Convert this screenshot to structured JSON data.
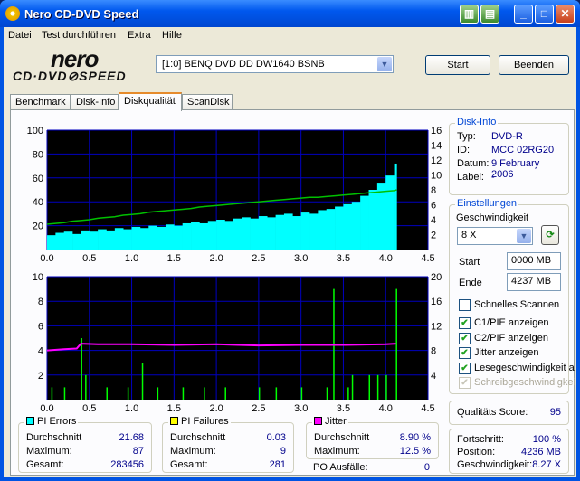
{
  "window": {
    "title": "Nero CD-DVD Speed"
  },
  "menu": [
    "Datei",
    "Test durchführen",
    "Extra",
    "Hilfe"
  ],
  "logo": {
    "top": "nero",
    "bottom": "CD·DVD SPEED"
  },
  "drive": {
    "selected": "[1:0]  BENQ DVD DD DW1640 BSNB"
  },
  "buttons": {
    "start": "Start",
    "end": "Beenden"
  },
  "tabs": [
    "Benchmark",
    "Disk-Info",
    "Diskqualität",
    "ScanDisk"
  ],
  "active_tab": "Diskqualität",
  "disk_info": {
    "title": "Disk-Info",
    "rows": [
      {
        "k": "Typ:",
        "v": "DVD-R"
      },
      {
        "k": "ID:",
        "v": "MCC 02RG20"
      },
      {
        "k": "Datum:",
        "v": "9 February 2006"
      },
      {
        "k": "Label:",
        "v": "-"
      }
    ]
  },
  "settings": {
    "title": "Einstellungen",
    "speed_label": "Geschwindigkeit",
    "speed": "8 X",
    "start_label": "Start",
    "start": "0000 MB",
    "end_label": "Ende",
    "end": "4237 MB",
    "checks": [
      {
        "label": "Schnelles Scannen",
        "checked": false,
        "disabled": false
      },
      {
        "label": "C1/PIE anzeigen",
        "checked": true,
        "disabled": false
      },
      {
        "label": "C2/PIF anzeigen",
        "checked": true,
        "disabled": false
      },
      {
        "label": "Jitter anzeigen",
        "checked": true,
        "disabled": false
      },
      {
        "label": "Lesegeschwindigkeit a",
        "checked": true,
        "disabled": false
      },
      {
        "label": "Schreibgeschwindigkei",
        "checked": true,
        "disabled": true
      }
    ]
  },
  "score": {
    "label": "Qualitäts Score:",
    "value": "95"
  },
  "progress": {
    "rows": [
      {
        "k": "Fortschritt:",
        "v": "100 %"
      },
      {
        "k": "Position:",
        "v": "4236 MB"
      },
      {
        "k": "Geschwindigkeit:",
        "v": "8.27 X"
      }
    ]
  },
  "pi_errors": {
    "title": "PI Errors",
    "color": "#00ffff",
    "rows": [
      {
        "k": "Durchschnitt",
        "v": "21.68"
      },
      {
        "k": "Maximum:",
        "v": "87"
      },
      {
        "k": "Gesamt:",
        "v": "283456"
      }
    ]
  },
  "pi_failures": {
    "title": "PI Failures",
    "color": "#ffff00",
    "rows": [
      {
        "k": "Durchschnitt",
        "v": "0.03"
      },
      {
        "k": "Maximum:",
        "v": "9"
      },
      {
        "k": "Gesamt:",
        "v": "281"
      }
    ]
  },
  "jitter": {
    "title": "Jitter",
    "color": "#ff00ff",
    "rows": [
      {
        "k": "Durchschnitt",
        "v": "8.90 %"
      },
      {
        "k": "Maximum:",
        "v": "12.5 %"
      }
    ]
  },
  "po": {
    "label": "PO Ausfälle:",
    "value": "0"
  },
  "chart_data": [
    {
      "type": "area",
      "title": "PI Errors / Read speed",
      "xlim": [
        0,
        4.5
      ],
      "ylim": [
        0,
        100
      ],
      "y2lim": [
        0,
        16
      ],
      "xticks": [
        "0.0",
        "0.5",
        "1.0",
        "1.5",
        "2.0",
        "2.5",
        "3.0",
        "3.5",
        "4.0",
        "4.5"
      ],
      "yticks": [
        "20",
        "40",
        "60",
        "80",
        "100"
      ],
      "y2ticks": [
        "2",
        "4",
        "6",
        "8",
        "10",
        "12",
        "14",
        "16"
      ],
      "x": [
        0,
        0.1,
        0.2,
        0.3,
        0.4,
        0.5,
        0.6,
        0.7,
        0.8,
        0.9,
        1.0,
        1.1,
        1.2,
        1.3,
        1.4,
        1.5,
        1.6,
        1.7,
        1.8,
        1.9,
        2.0,
        2.1,
        2.2,
        2.3,
        2.4,
        2.5,
        2.6,
        2.7,
        2.8,
        2.9,
        3.0,
        3.1,
        3.2,
        3.3,
        3.4,
        3.5,
        3.6,
        3.7,
        3.8,
        3.9,
        4.0,
        4.1,
        4.13
      ],
      "pi_errors": [
        12,
        14,
        15,
        13,
        16,
        15,
        17,
        16,
        18,
        17,
        19,
        18,
        20,
        19,
        21,
        20,
        22,
        23,
        22,
        24,
        25,
        24,
        26,
        27,
        26,
        28,
        27,
        29,
        30,
        28,
        31,
        30,
        33,
        34,
        36,
        38,
        40,
        45,
        50,
        56,
        62,
        72,
        87
      ],
      "read_speed": [
        3.4,
        3.5,
        3.6,
        3.8,
        3.9,
        4.0,
        4.2,
        4.3,
        4.4,
        4.6,
        4.7,
        4.8,
        5.0,
        5.1,
        5.2,
        5.3,
        5.4,
        5.5,
        5.7,
        5.8,
        5.9,
        6.0,
        6.1,
        6.2,
        6.3,
        6.4,
        6.5,
        6.6,
        6.7,
        6.8,
        6.9,
        7.0,
        7.0,
        7.1,
        7.2,
        7.3,
        7.4,
        7.5,
        7.6,
        7.7,
        7.8,
        7.9,
        8.0
      ]
    },
    {
      "type": "bar",
      "title": "PI Failures / Jitter",
      "xlim": [
        0,
        4.5
      ],
      "ylim": [
        0,
        10
      ],
      "y2lim": [
        0,
        20
      ],
      "xticks": [
        "0.0",
        "0.5",
        "1.0",
        "1.5",
        "2.0",
        "2.5",
        "3.0",
        "3.5",
        "4.0",
        "4.5"
      ],
      "yticks": [
        "2",
        "4",
        "6",
        "8",
        "10"
      ],
      "y2ticks": [
        "4",
        "8",
        "12",
        "16",
        "20"
      ],
      "pif_x": [
        0.05,
        0.2,
        0.4,
        0.45,
        0.7,
        0.95,
        1.12,
        1.3,
        1.6,
        1.85,
        2.1,
        2.5,
        2.7,
        3.0,
        3.3,
        3.38,
        3.55,
        3.6,
        3.8,
        3.9,
        4.0,
        4.12
      ],
      "pif": [
        1,
        1,
        5,
        2,
        1,
        1,
        3,
        1,
        1,
        1,
        1,
        1,
        1,
        1,
        1,
        9,
        1,
        2,
        2,
        2,
        2,
        9
      ],
      "jitter_x": [
        0,
        0.2,
        0.35,
        0.4,
        0.6,
        1.0,
        1.5,
        2.0,
        2.5,
        3.0,
        3.5,
        4.0,
        4.12
      ],
      "jitter": [
        8.0,
        8.2,
        8.3,
        9.1,
        9.0,
        9.0,
        8.9,
        9.0,
        8.8,
        8.9,
        8.9,
        9.0,
        9.1
      ]
    }
  ]
}
